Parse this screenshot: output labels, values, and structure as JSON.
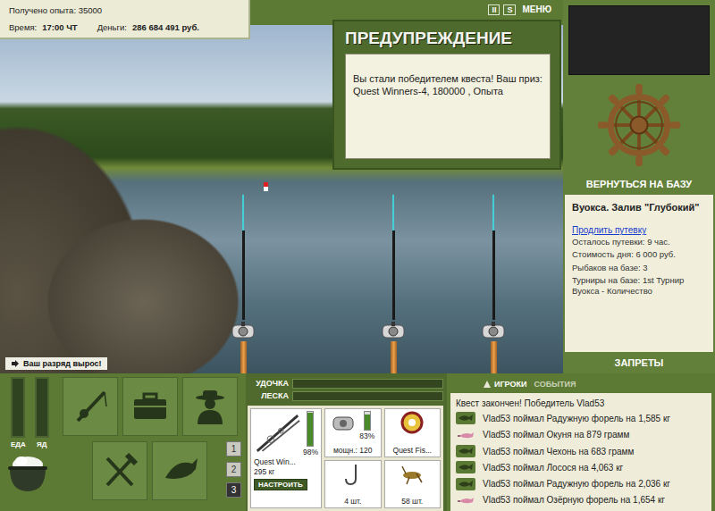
{
  "stats": {
    "experience": "Получено опыта: 35000",
    "time_label": "Время:",
    "time": "17:00 ЧТ",
    "money_label": "Деньги:",
    "money": "286 684 491 руб."
  },
  "top_buttons": [
    {
      "label": "II"
    },
    {
      "label": "S"
    },
    {
      "label": "МЕНЮ"
    }
  ],
  "warning": {
    "title": "ПРЕДУПРЕЖДЕНИЕ",
    "message": "Вы стали победителем квеста! Ваш приз: Quest Winners-4, 180000 , Опыта"
  },
  "notice": "Ваш разряд вырос!",
  "rods": [
    {
      "has_float": true
    },
    {
      "has_float": false
    },
    {
      "has_float": false
    }
  ],
  "base": {
    "button": "ВЕРНУТЬСЯ НА БАЗУ",
    "location": "Вуокса. Залив \"Глубокий\"",
    "extend_link": "Продлить путевку",
    "details": [
      "Осталось путевки: 9 час.",
      "Стоимость дня: 6 000 руб.",
      "Рыбаков на базе: 3",
      "Турниры на базе: 1st Турнир Вуокса - Количество"
    ],
    "bans": "ЗАПРЕТЫ"
  },
  "needs": [
    {
      "label": "ЕДА",
      "level": 0
    },
    {
      "label": "ЯД",
      "level": 0
    }
  ],
  "pages": [
    {
      "label": "1",
      "selected": false
    },
    {
      "label": "2",
      "selected": false
    },
    {
      "label": "3",
      "selected": true
    }
  ],
  "gauges": [
    {
      "label": "УДОЧКА",
      "level": 0
    },
    {
      "label": "ЛЕСКА",
      "level": 0
    }
  ],
  "tackle": {
    "rod": {
      "name": "Quest Win...",
      "weight": "295 кг",
      "condition": "98%",
      "level": 0.98,
      "button": "НАСТРОИТЬ"
    },
    "reel": {
      "power": "мощн.: 120",
      "condition": "83%",
      "level": 0.83
    },
    "line": {
      "name": "Quest Fis..."
    },
    "hook": {
      "count": "4 шт."
    },
    "bait": {
      "count": "58 шт."
    }
  },
  "feed": {
    "tabs": [
      {
        "label": "ИГРОКИ",
        "selected": true
      },
      {
        "label": "СОБЫТИЯ",
        "selected": false
      }
    ],
    "header": "Квест закончен! Победитель Vlad53",
    "events": [
      {
        "kind": "fish",
        "text": "Vlad53 поймал Радужную форель на 1,585 кг"
      },
      {
        "kind": "lure",
        "text": "Vlad53 поймал Окуня на 879 грамм"
      },
      {
        "kind": "fish",
        "text": "Vlad53 поймал Чехонь на 683 грамм"
      },
      {
        "kind": "fish",
        "text": "Vlad53 поймал Лосося на 4,063 кг"
      },
      {
        "kind": "fish",
        "text": "Vlad53 поймал Радужную форель на 2,036 кг"
      },
      {
        "kind": "lure",
        "text": "Vlad53 поймал Озёрную форель на 1,654 кг"
      }
    ]
  }
}
